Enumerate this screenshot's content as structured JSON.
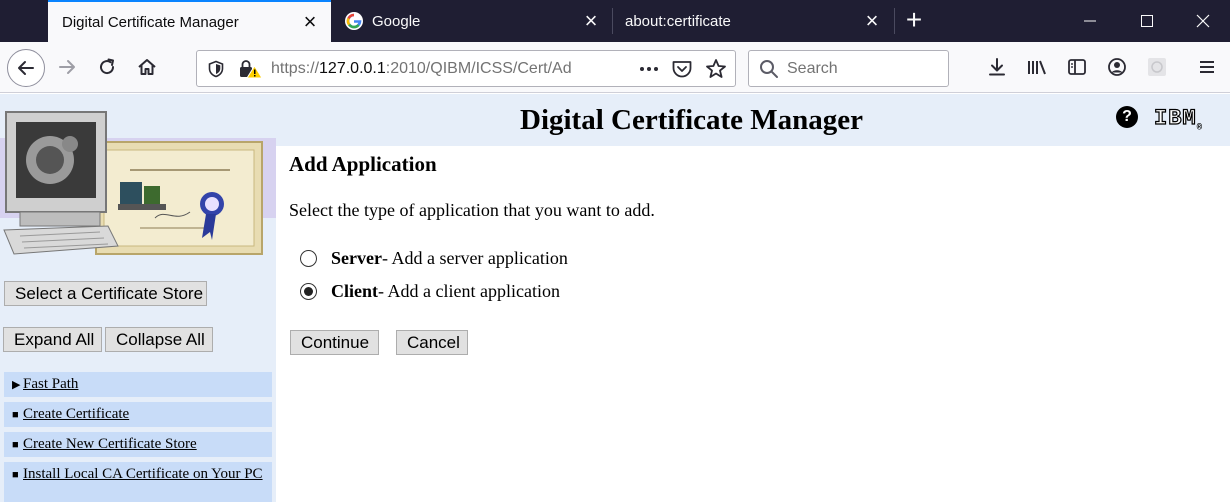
{
  "tabs": [
    {
      "title": "Digital Certificate Manager",
      "active": true,
      "favicon": "none"
    },
    {
      "title": "Google",
      "active": false,
      "favicon": "google-logo-icon"
    },
    {
      "title": "about:certificate",
      "active": false,
      "favicon": "none"
    }
  ],
  "urlbar": {
    "scheme": "https://",
    "host": "127.0.0.1",
    "path": ":2010/QIBM/ICSS/Cert/Ad"
  },
  "search": {
    "placeholder": "Search"
  },
  "page": {
    "title": "Digital Certificate Manager",
    "ibm_logo": "IBM",
    "help": "?"
  },
  "sidebar": {
    "select_store_button": "Select a Certificate Store",
    "expand_all_button": "Expand All",
    "collapse_all_button": "Collapse All",
    "items": [
      {
        "label": "Fast Path",
        "bullet": "▶"
      },
      {
        "label": "Create Certificate",
        "bullet": "■"
      },
      {
        "label": "Create New Certificate Store",
        "bullet": "■"
      },
      {
        "label": "Install Local CA Certificate on Your PC",
        "bullet": "■"
      }
    ]
  },
  "main": {
    "heading": "Add Application",
    "instruction": "Select the type of application that you want to add.",
    "options": [
      {
        "name": "Server",
        "description": " - Add a server application",
        "checked": false
      },
      {
        "name": "Client",
        "description": " - Add a client application",
        "checked": true
      }
    ],
    "continue_button": "Continue",
    "cancel_button": "Cancel"
  },
  "colors": {
    "tabstrip": "#1f1e33",
    "active_tab_accent": "#0a84ff",
    "page_header": "#e6eef9",
    "fastpath_item": "#c8dcf8"
  }
}
